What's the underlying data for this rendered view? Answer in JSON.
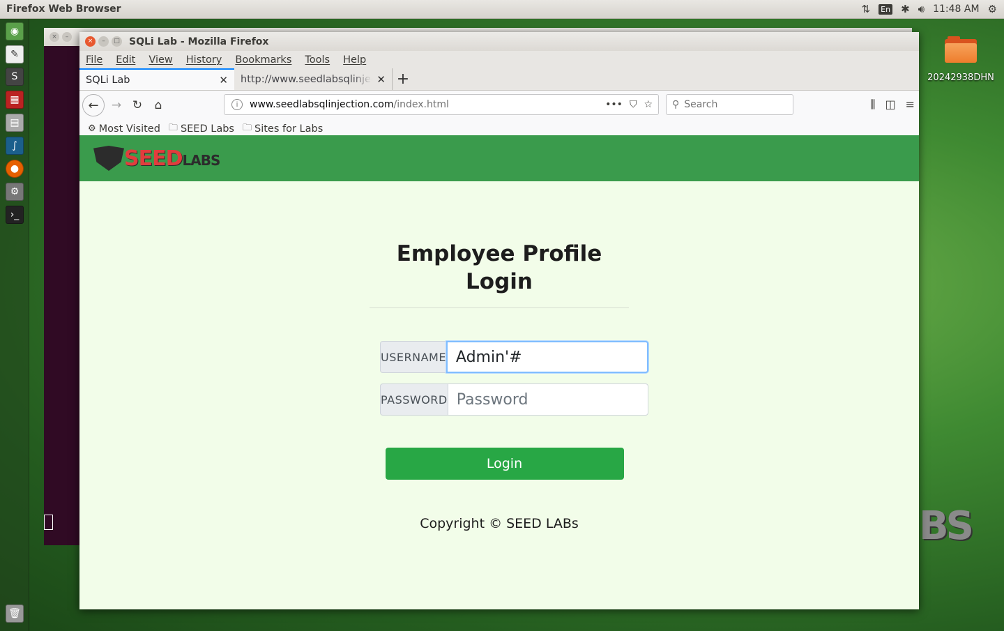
{
  "top_panel": {
    "app_title": "Firefox Web Browser",
    "clock": "11:48 AM",
    "lang": "En"
  },
  "desktop": {
    "folder_label": "20242938DHN"
  },
  "browser": {
    "window_title": "SQLi Lab - Mozilla Firefox",
    "menu": [
      "File",
      "Edit",
      "View",
      "History",
      "Bookmarks",
      "Tools",
      "Help"
    ],
    "tabs": [
      {
        "label": "SQLi Lab",
        "active": true
      },
      {
        "label": "http://www.seedlabsqlinjection.com",
        "active": false
      }
    ],
    "url_host": "www.seedlabsqlinjection.com",
    "url_path": "/index.html",
    "search_placeholder": "Search",
    "bookmarks": [
      {
        "label": "Most Visited",
        "icon": "gear-icon"
      },
      {
        "label": "SEED Labs",
        "icon": "folder-icon"
      },
      {
        "label": "Sites for Labs",
        "icon": "folder-icon"
      }
    ]
  },
  "page": {
    "logo_seed": "SEED",
    "logo_labs": "LABS",
    "title_line1": "Employee Profile",
    "title_line2": "Login",
    "username_label": "USERNAME",
    "username_value": "Admin'#",
    "password_label": "PASSWORD",
    "password_placeholder": "Password",
    "login_label": "Login",
    "copyright": "Copyright © SEED LABs",
    "colors": {
      "header": "#3a9b4c",
      "background": "#f2fde9",
      "button": "#28a745"
    }
  }
}
